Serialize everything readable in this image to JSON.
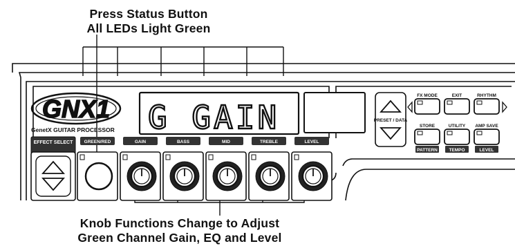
{
  "callouts": {
    "top_line1": "Press Status Button",
    "top_line2": "All LEDs Light Green",
    "bottom_line1": "Knob Functions Change to Adjust",
    "bottom_line2": "Green Channel Gain, EQ and Level"
  },
  "device": {
    "logo": "GNX1",
    "subtitle": "GenetX GUITAR PROCESSOR",
    "display_text": "G GAIN",
    "effect_select_label": "EFFECT SELECT",
    "preset_data_label": "PRESET / DATA",
    "modules": [
      {
        "label": "GREEN/RED"
      },
      {
        "label": "GAIN"
      },
      {
        "label": "BASS"
      },
      {
        "label": "MID"
      },
      {
        "label": "TREBLE"
      },
      {
        "label": "LEVEL"
      }
    ],
    "buttons": [
      {
        "top": "FX MODE",
        "bottom": ""
      },
      {
        "top": "EXIT",
        "bottom": ""
      },
      {
        "top": "RHYTHM",
        "bottom": ""
      },
      {
        "top": "STORE",
        "bottom": "PATTERN"
      },
      {
        "top": "UTILITY",
        "bottom": "TEMPO"
      },
      {
        "top": "AMP SAVE",
        "bottom": "LEVEL"
      }
    ]
  }
}
